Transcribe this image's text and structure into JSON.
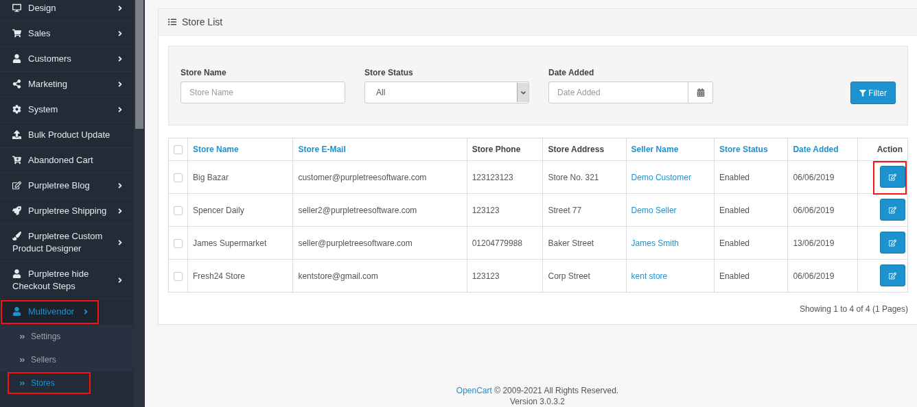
{
  "sidebar": {
    "items": [
      {
        "label": "Design",
        "arrow": true,
        "selected": false,
        "highlighted": false
      },
      {
        "label": "Sales",
        "arrow": true,
        "selected": false,
        "highlighted": false
      },
      {
        "label": "Customers",
        "arrow": true,
        "selected": false,
        "highlighted": false
      },
      {
        "label": "Marketing",
        "arrow": true,
        "selected": false,
        "highlighted": false
      },
      {
        "label": "System",
        "arrow": true,
        "selected": false,
        "highlighted": false
      },
      {
        "label": "Bulk Product Update",
        "arrow": false,
        "selected": false,
        "highlighted": false
      },
      {
        "label": "Abandoned Cart",
        "arrow": false,
        "selected": false,
        "highlighted": false
      },
      {
        "label": "Purpletree Blog",
        "arrow": true,
        "selected": false,
        "highlighted": false
      },
      {
        "label": "Purpletree Shipping",
        "arrow": true,
        "selected": false,
        "highlighted": false
      },
      {
        "label": "Purpletree Custom Product Designer",
        "arrow": true,
        "selected": false,
        "highlighted": false
      },
      {
        "label": "Purpletree hide Checkout Steps",
        "arrow": true,
        "selected": false,
        "highlighted": false
      },
      {
        "label": "Multivendor",
        "arrow": true,
        "selected": true,
        "highlighted": true,
        "children": [
          {
            "label": "Settings",
            "selected": false,
            "highlighted": false
          },
          {
            "label": "Sellers",
            "selected": false,
            "highlighted": false
          },
          {
            "label": "Stores",
            "selected": true,
            "highlighted": true
          }
        ]
      }
    ]
  },
  "panel": {
    "title": "Store List",
    "filter": {
      "fields": [
        {
          "kind": "text",
          "label": "Store Name",
          "placeholder": "Store Name"
        },
        {
          "kind": "select",
          "label": "Store Status",
          "value": "All"
        },
        {
          "kind": "date",
          "label": "Date Added",
          "placeholder": "Date Added"
        }
      ],
      "button": "Filter"
    },
    "table": {
      "select_all_checked": false,
      "columns": [
        {
          "label": "Store Name",
          "sortable": true
        },
        {
          "label": "Store E-Mail",
          "sortable": true
        },
        {
          "label": "Store Phone",
          "sortable": false
        },
        {
          "label": "Store Address",
          "sortable": false
        },
        {
          "label": "Seller Name",
          "sortable": true
        },
        {
          "label": "Store Status",
          "sortable": true
        },
        {
          "label": "Date Added",
          "sortable": true
        },
        {
          "label": "Action",
          "sortable": false
        }
      ],
      "rows": [
        {
          "checked": false,
          "cells": [
            "Big Bazar",
            "customer@purpletreesoftware.com",
            "123123123",
            "Store No. 321",
            "Demo Customer",
            "Enabled",
            "06/06/2019"
          ],
          "action_highlighted": true
        },
        {
          "checked": false,
          "cells": [
            "Spencer Daily",
            "seller2@purpletreesoftware.com",
            "123123",
            "Street 77",
            "Demo Seller",
            "Enabled",
            "06/06/2019"
          ],
          "action_highlighted": false
        },
        {
          "checked": false,
          "cells": [
            "James Supermarket",
            "seller@purpletreesoftware.com",
            "01204779988",
            "Baker Street",
            "James Smith",
            "Enabled",
            "13/06/2019"
          ],
          "action_highlighted": false
        },
        {
          "checked": false,
          "cells": [
            "Fresh24 Store",
            "kentstore@gmail.com",
            "123123",
            "Corp Street",
            "kent store",
            "Enabled",
            "06/06/2019"
          ],
          "action_highlighted": false
        }
      ]
    },
    "pagination_text": "Showing 1 to 4 of 4 (1 Pages)"
  },
  "footer": {
    "link": "OpenCart",
    "text": "© 2009-2021 All Rights Reserved.",
    "version": "Version 3.0.3.2"
  }
}
